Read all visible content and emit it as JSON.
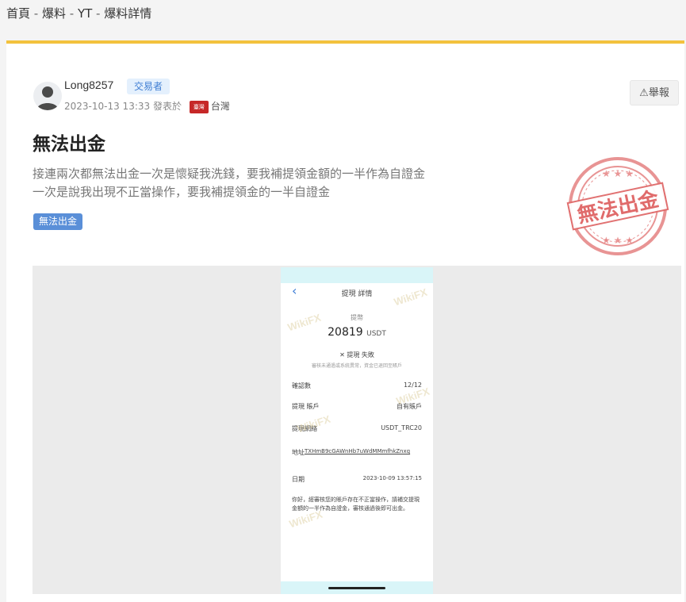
{
  "breadcrumb": {
    "home": "首頁",
    "exposure": "爆料",
    "broker": "YT",
    "detail": "爆料詳情",
    "separator": " - "
  },
  "author": {
    "username": "Long8257",
    "role": "交易者",
    "datetime": "2023-10-13 13:33",
    "posted_in": "發表於",
    "flag_label": "臺灣",
    "region": "台灣"
  },
  "report_button": {
    "label": "舉報",
    "icon": "warning-icon"
  },
  "post": {
    "title": "無法出金",
    "body_lines": [
      "接連兩次都無法出金一次是懷疑我洗錢，要我補提領金額的一半作為自證金",
      "一次是說我出現不正當操作，要我補提領金的一半自證金"
    ],
    "tag": "無法出金"
  },
  "stamp": {
    "text": "無法出金",
    "color": "#e06b6b"
  },
  "screenshot": {
    "header": "提現 詳情",
    "amount_label": "提幣",
    "amount": "20819",
    "currency": "USDT",
    "status": "✕ 提現 失敗",
    "status_note": "審核未通過或系統異常，資金已退回至賬戶",
    "rows": [
      {
        "label": "確認數",
        "value": "12/12"
      },
      {
        "label": "提現 賬戶",
        "value": "自有賬戶"
      },
      {
        "label": "提現網絡",
        "value": "USDT_TRC20"
      },
      {
        "label": "地址",
        "value": "TXHmB9cGAWnHb7uWdMMmfhkZnxq"
      },
      {
        "label": "日期",
        "value": "2023-10-09 13:57:15"
      }
    ],
    "note": "你好，經審核您的賬戶存在不正當操作，請補交提現金額的一半作為自證金，審核通過後即可出金。",
    "watermark": "WikiFX"
  },
  "colors": {
    "accent": "#f3c23d",
    "badge_bg": "#e4f0fd",
    "badge_text": "#3f7ed3",
    "tag_bg": "#5a8fd8",
    "flag": "#c62828",
    "phone_bar": "#d9f5f8"
  }
}
